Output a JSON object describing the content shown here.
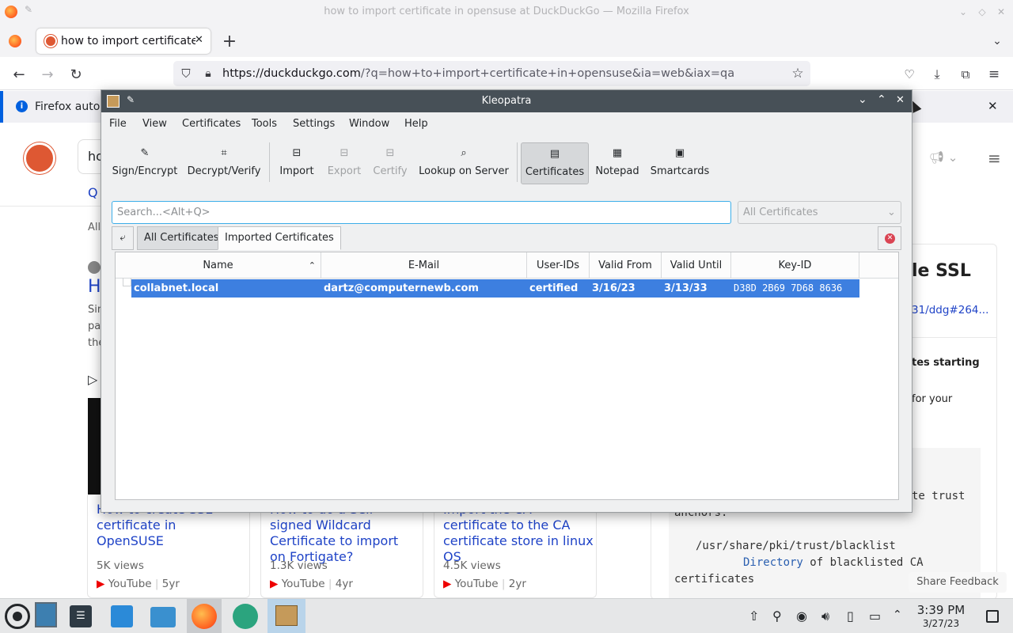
{
  "browser": {
    "window_title": "how to import certificate in opensuse at DuckDuckGo — Mozilla Firefox",
    "tab_title": "how to import certificate in opensuse at DuckDuckGo",
    "url_domain": "https://duckduckgo.com",
    "url_rest": "/?q=how+to+import+certificate+in+opensuse&ia=web&iax=qa",
    "notification": "Firefox autom"
  },
  "ddg": {
    "query_fragment": "ho",
    "result_title_fragment": "H",
    "result_snippet": [
      "Sin",
      "pa",
      "the"
    ],
    "all_fragment": "All",
    "right_panel": {
      "heading": "le SSL",
      "link": "31/ddg#264...",
      "text1": "tes starting",
      "text2": "for your",
      "code_frag": "te trust",
      "code_line1": "anchors.",
      "code_path": "/usr/share/pki/trust/blacklist",
      "code_dir": "Directory",
      "code_desc": "of blacklisted CA",
      "code_last": "certificates"
    },
    "videos": [
      {
        "title": "How to create SSL certificate in OpenSUSE",
        "views": "5K views",
        "source": "YouTube",
        "age": "5yr"
      },
      {
        "title": "How to do a Self-signed Wildcard Certificate to import on Fortigate?",
        "views": "1.3K views",
        "source": "YouTube",
        "age": "4yr"
      },
      {
        "title": "Import the CA certificate to the CA certificate store in linux OS",
        "views": "4.5K views",
        "source": "YouTube",
        "age": "2yr"
      }
    ],
    "share_feedback": "Share Feedback"
  },
  "kleopatra": {
    "title": "Kleopatra",
    "menu": [
      "File",
      "View",
      "Certificates",
      "Tools",
      "Settings",
      "Window",
      "Help"
    ],
    "toolbar": {
      "sign_encrypt": "Sign/Encrypt",
      "decrypt_verify": "Decrypt/Verify",
      "import": "Import",
      "export": "Export",
      "certify": "Certify",
      "lookup": "Lookup on Server",
      "certificates": "Certificates",
      "notepad": "Notepad",
      "smartcards": "Smartcards"
    },
    "search_placeholder": "Search...<Alt+Q>",
    "filter_value": "All Certificates",
    "tabs": [
      "All Certificates",
      "Imported Certificates"
    ],
    "columns": [
      "Name",
      "E-Mail",
      "User-IDs",
      "Valid From",
      "Valid Until",
      "Key-ID"
    ],
    "rows": [
      {
        "name": "collabnet.local",
        "email": "dartz@computernewb.com",
        "user_ids": "certified",
        "valid_from": "3/16/23",
        "valid_until": "3/13/33",
        "key_id": "D38D 2B69 7D68 8636"
      }
    ]
  },
  "taskbar": {
    "time": "3:39 PM",
    "date": "3/27/23"
  }
}
